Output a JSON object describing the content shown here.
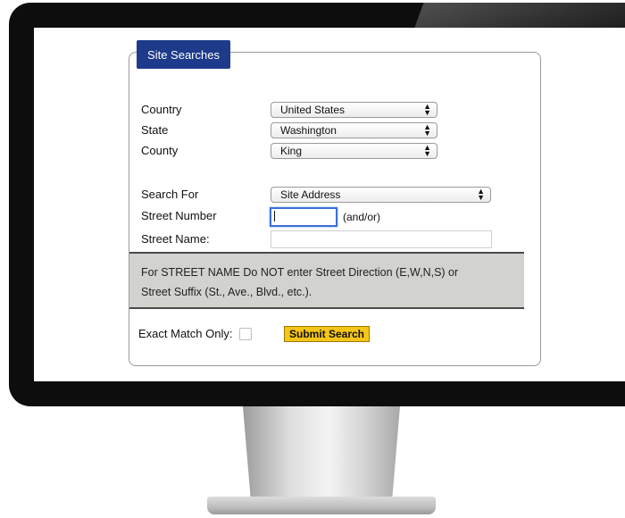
{
  "panel": {
    "title": "Site Searches"
  },
  "fields": {
    "country": {
      "label": "Country",
      "value": "United States"
    },
    "state": {
      "label": "State",
      "value": "Washington"
    },
    "county": {
      "label": "County",
      "value": "King"
    },
    "search_for": {
      "label": "Search For",
      "value": "Site Address"
    },
    "street_number": {
      "label": "Street Number",
      "value": "",
      "hint": "(and/or)"
    },
    "street_name": {
      "label": "Street Name:",
      "value": ""
    }
  },
  "note": {
    "line1": "For STREET NAME Do NOT enter Street Direction (E,W,N,S) or",
    "line2": "Street Suffix (St., Ave., Blvd., etc.)."
  },
  "exact_match": {
    "label": "Exact Match Only:",
    "checked": false
  },
  "submit": {
    "label": "Submit Search"
  },
  "colors": {
    "tab": "#1e3a8a",
    "submit": "#f5c518",
    "note_bg": "#d2d2cf"
  },
  "icons": {
    "select_arrows": "up-down-arrows-icon"
  }
}
